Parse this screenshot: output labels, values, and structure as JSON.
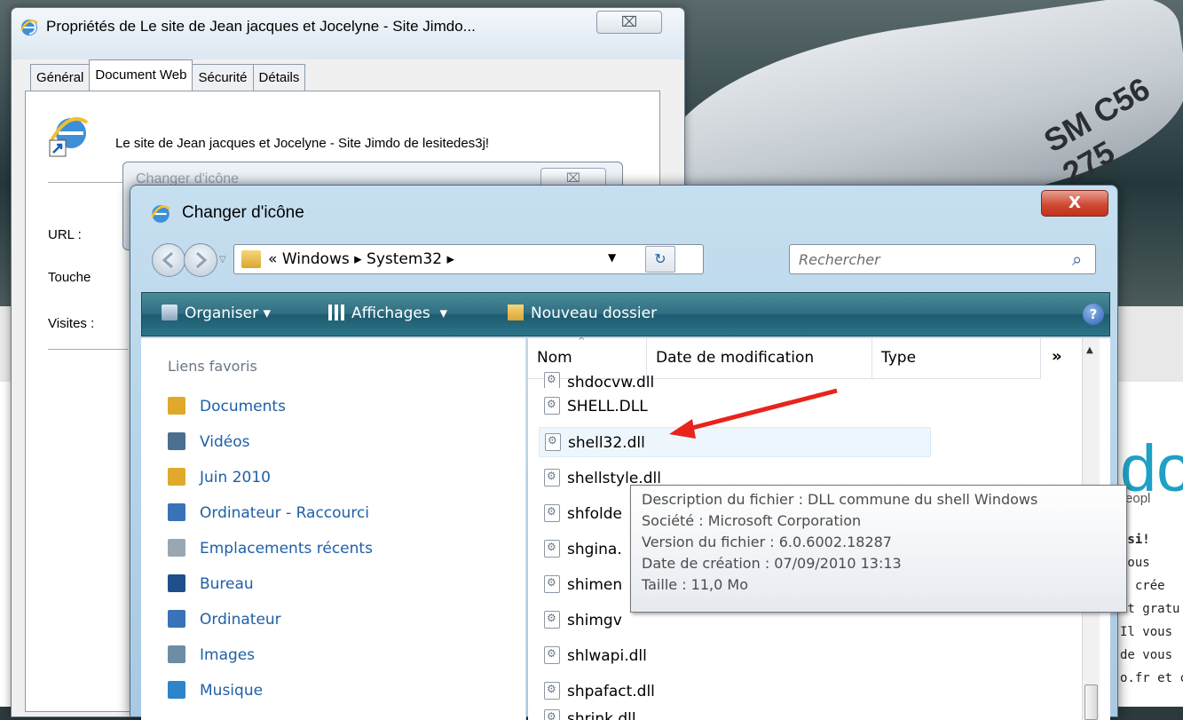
{
  "background": {
    "boat_registration": "SM C56 275",
    "logo_fragment": "do",
    "tagline_fragment": "Peopl",
    "text_lines": [
      "ssi!",
      "Vous",
      "s crée",
      "et gratu",
      "Il vous",
      "de vous",
      "o.fr et c"
    ],
    "link_fragment": "o.fr"
  },
  "properties_dialog": {
    "title": "Propriétés de Le site de Jean jacques et Jocelyne - Site Jimdo...",
    "close_label": "⌧",
    "tabs": [
      "Général",
      "Document Web",
      "Sécurité",
      "Détails"
    ],
    "page_name": "Le site de Jean jacques et Jocelyne - Site Jimdo de lesitedes3j!",
    "fields": {
      "url": "URL :",
      "shortcut": "Touche",
      "visits": "Visites :"
    }
  },
  "old_dialog": {
    "title": "Changer d'icône",
    "close_label": "⌧"
  },
  "dialog": {
    "title": "Changer d'icône",
    "close_label": "X",
    "address": {
      "prefix": "«",
      "path": [
        "Windows",
        "System32"
      ]
    },
    "search_placeholder": "Rechercher",
    "toolbar": {
      "organize": "Organiser",
      "views": "Affichages",
      "new_folder": "Nouveau dossier",
      "help": "?"
    },
    "favorites": {
      "header": "Liens favoris",
      "items": [
        {
          "label": "Documents",
          "icon": "folder-icon",
          "color": "#e0a92c"
        },
        {
          "label": "Vidéos",
          "icon": "video-icon",
          "color": "#4b6f8e"
        },
        {
          "label": "Juin 2010",
          "icon": "folder-icon",
          "color": "#e0a92c"
        },
        {
          "label": "Ordinateur - Raccourci",
          "icon": "computer-icon",
          "color": "#3a72b8"
        },
        {
          "label": "Emplacements récents",
          "icon": "recent-icon",
          "color": "#9aa7b3"
        },
        {
          "label": "Bureau",
          "icon": "desktop-icon",
          "color": "#1f4f8a"
        },
        {
          "label": "Ordinateur",
          "icon": "computer-icon",
          "color": "#3a72b8"
        },
        {
          "label": "Images",
          "icon": "images-icon",
          "color": "#6d8da5"
        },
        {
          "label": "Musique",
          "icon": "music-icon",
          "color": "#2d84c8"
        }
      ]
    },
    "columns": {
      "name": "Nom",
      "date": "Date de modification",
      "type": "Type",
      "more": "»"
    },
    "files": [
      "shdocvw.dll",
      "SHELL.DLL",
      "shell32.dll",
      "shellstyle.dll",
      "shfolde",
      "shgina.",
      "shimen",
      "shimgv",
      "shlwapi.dll",
      "shpafact.dll",
      "shrink.dll"
    ],
    "hovered_file": "shell32.dll",
    "tooltip": [
      "Description du fichier : DLL commune du shell Windows",
      "Société : Microsoft Corporation",
      "Version du fichier : 6.0.6002.18287",
      "Date de création : 07/09/2010 13:13",
      "Taille : 11,0 Mo"
    ]
  },
  "annotation": {
    "arrow_color": "#e8241c"
  }
}
